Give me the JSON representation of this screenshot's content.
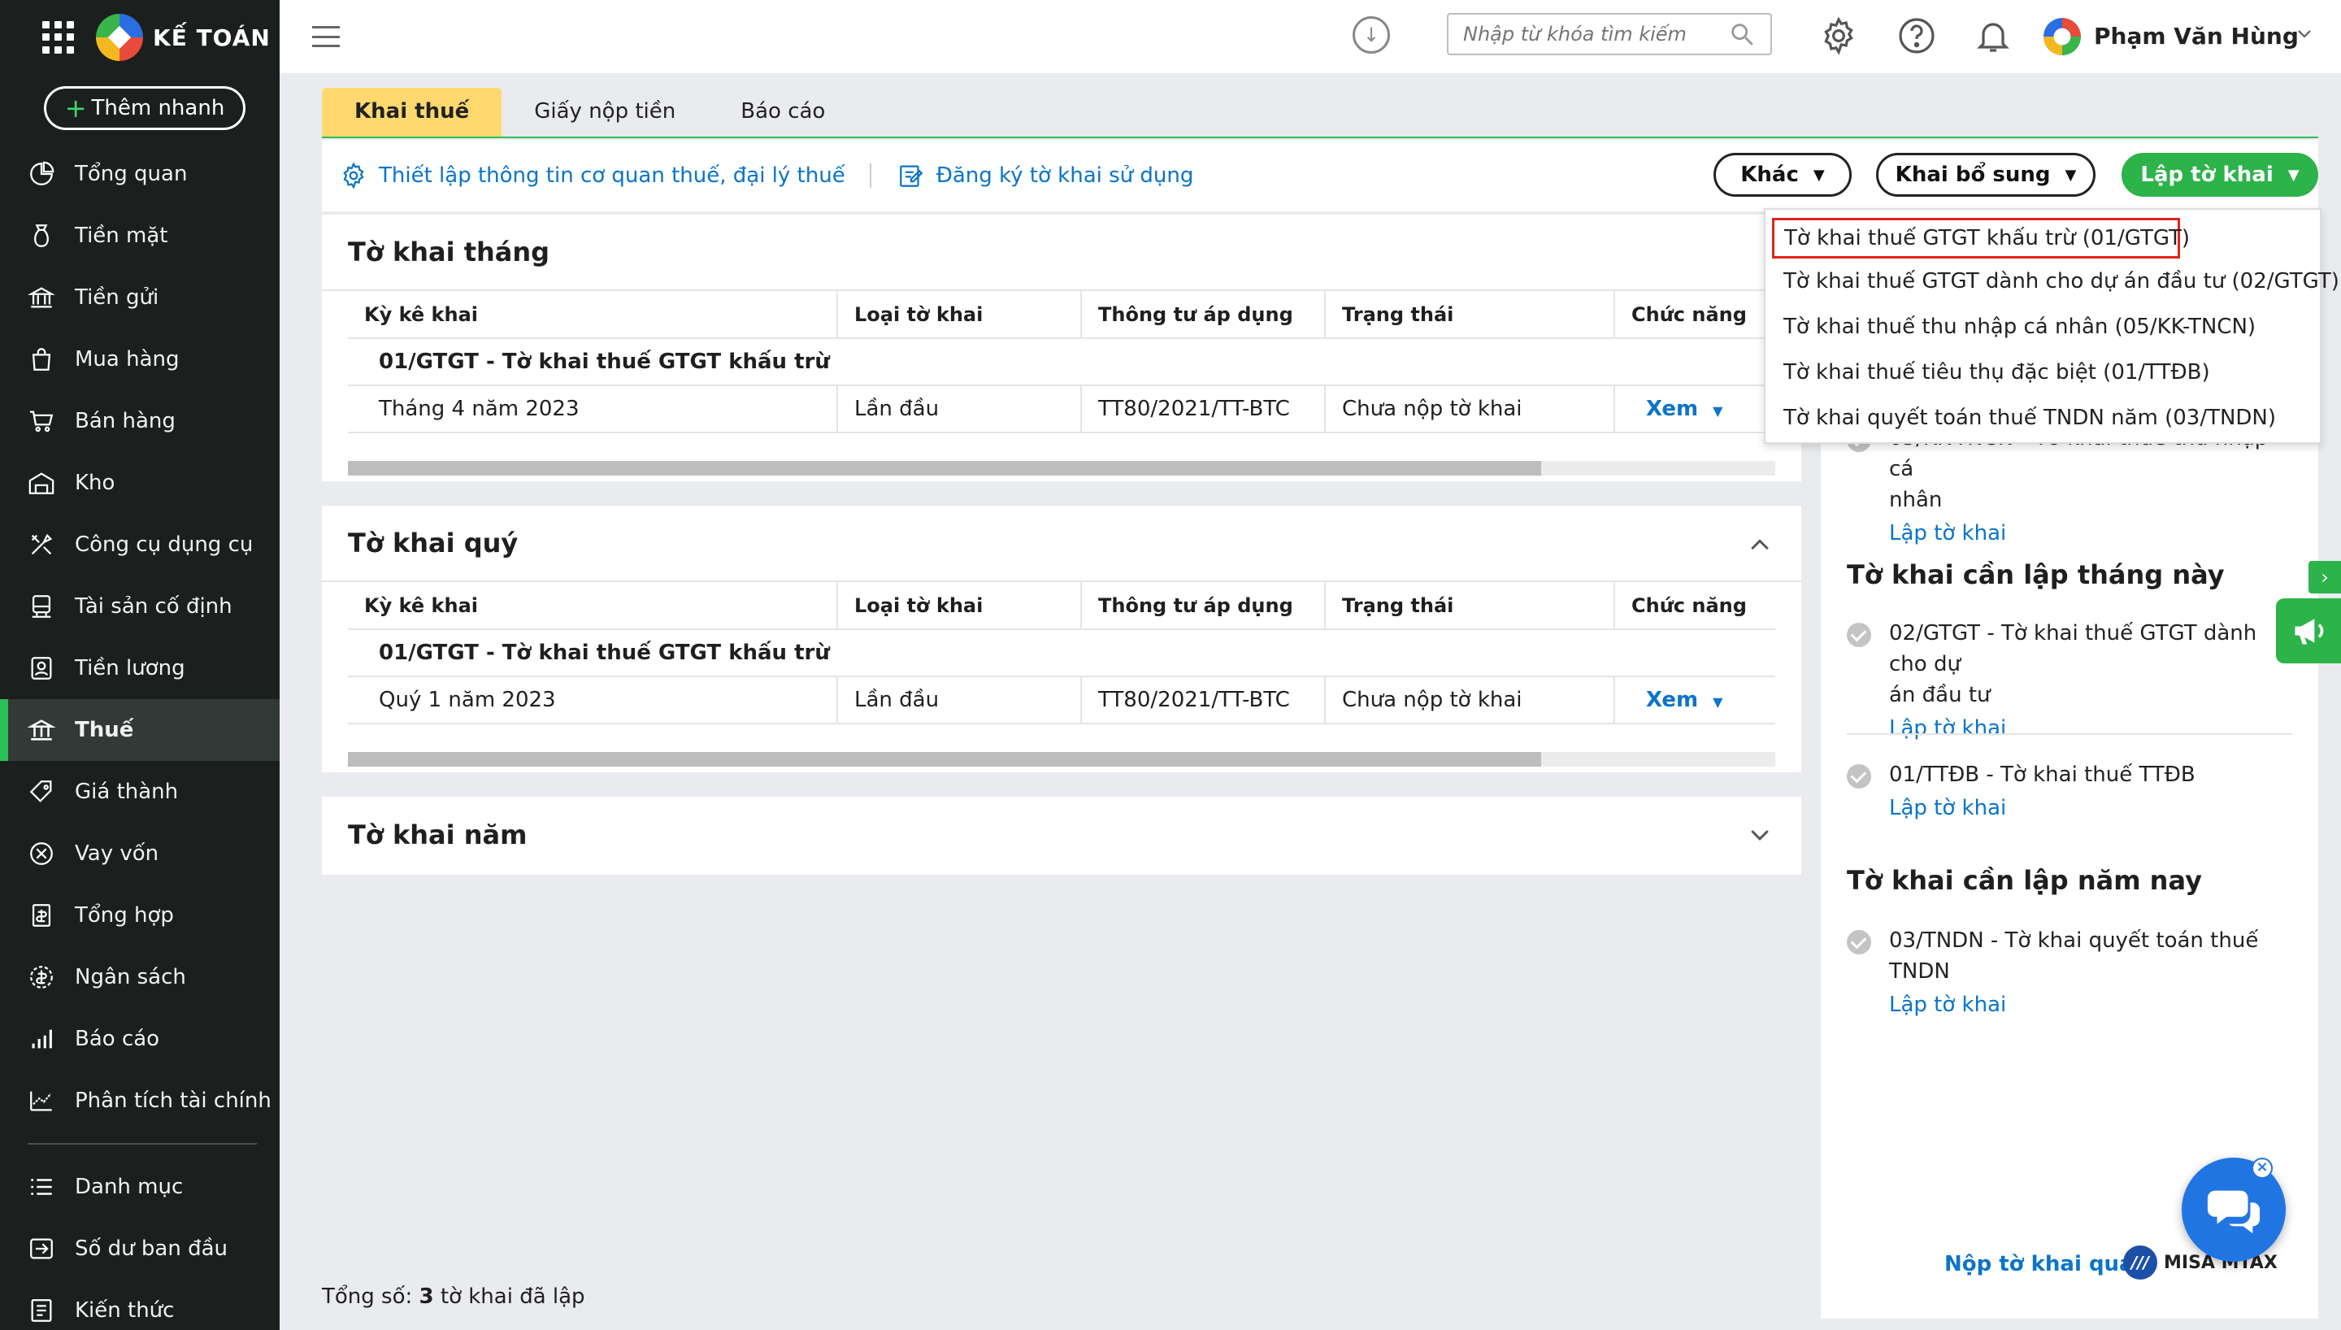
{
  "app": {
    "name": "KẾ TOÁN",
    "quick_add": "Thêm nhanh"
  },
  "sidebar": {
    "items": [
      {
        "label": "Tổng quan",
        "icon": "dashboard-icon"
      },
      {
        "label": "Tiền mặt",
        "icon": "cash-icon"
      },
      {
        "label": "Tiền gửi",
        "icon": "bank-icon"
      },
      {
        "label": "Mua hàng",
        "icon": "shopping-bag-icon"
      },
      {
        "label": "Bán hàng",
        "icon": "cart-icon"
      },
      {
        "label": "Kho",
        "icon": "warehouse-icon"
      },
      {
        "label": "Công cụ dụng cụ",
        "icon": "tools-icon"
      },
      {
        "label": "Tài sản cố định",
        "icon": "asset-icon"
      },
      {
        "label": "Tiền lương",
        "icon": "payroll-icon"
      },
      {
        "label": "Thuế",
        "icon": "tax-icon",
        "active": true
      },
      {
        "label": "Giá thành",
        "icon": "price-tag-icon"
      },
      {
        "label": "Vay vốn",
        "icon": "loan-icon"
      },
      {
        "label": "Tổng hợp",
        "icon": "summary-icon"
      },
      {
        "label": "Ngân sách",
        "icon": "budget-icon"
      },
      {
        "label": "Báo cáo",
        "icon": "report-chart-icon"
      },
      {
        "label": "Phân tích tài chính",
        "icon": "analysis-icon"
      },
      {
        "label": "Danh mục",
        "icon": "list-icon"
      },
      {
        "label": "Số dư ban đầu",
        "icon": "opening-balance-icon"
      },
      {
        "label": "Kiến thức",
        "icon": "knowledge-icon"
      }
    ]
  },
  "topbar": {
    "search_placeholder": "Nhập từ khóa tìm kiếm",
    "user_name": "Phạm Văn Hùng"
  },
  "tabs": [
    {
      "label": "Khai thuế",
      "active": true
    },
    {
      "label": "Giấy nộp tiền"
    },
    {
      "label": "Báo cáo"
    }
  ],
  "actions": {
    "setup_link": "Thiết lập thông tin cơ quan thuế, đại lý thuế",
    "register_link": "Đăng ký tờ khai sử dụng",
    "other": "Khác",
    "supplement": "Khai bổ sung",
    "create": "Lập tờ khai"
  },
  "columns": [
    "Kỳ kê khai",
    "Loại tờ khai",
    "Thông tư áp dụng",
    "Trạng thái",
    "Chức năng"
  ],
  "monthly": {
    "title": "Tờ khai tháng",
    "group": "01/GTGT - Tờ khai thuế GTGT khấu trừ",
    "row": {
      "period": "Tháng 4 năm 2023",
      "type": "Lần đầu",
      "circular": "TT80/2021/TT-BTC",
      "status": "Chưa nộp tờ khai",
      "action": "Xem"
    }
  },
  "quarterly": {
    "title": "Tờ khai quý",
    "group": "01/GTGT - Tờ khai thuế GTGT khấu trừ",
    "row": {
      "period": "Quý 1 năm 2023",
      "type": "Lần đầu",
      "circular": "TT80/2021/TT-BTC",
      "status": "Chưa nộp tờ khai",
      "action": "Xem"
    }
  },
  "yearly": {
    "title": "Tờ khai năm"
  },
  "footer": {
    "label": "Tổng số:",
    "count": "3",
    "suffix": "tờ khai đã lập"
  },
  "right_panel": {
    "partial_item": {
      "text_line1": "05/KK-TNCN - Tờ khai thuế thu nhập cá",
      "text_line2": "nhân",
      "link": "Lập tờ khai"
    },
    "month_heading": "Tờ khai cần lập tháng này",
    "month_items": [
      {
        "text_line1": "02/GTGT - Tờ khai thuế GTGT dành cho dự",
        "text_line2": "án đầu tư",
        "link": "Lập tờ khai"
      },
      {
        "text_line1": "01/TTĐB - Tờ khai thuế TTĐB",
        "link": "Lập tờ khai"
      }
    ],
    "year_heading": "Tờ khai cần lập năm nay",
    "year_items": [
      {
        "text_line1": "03/TNDN - Tờ khai quyết toán thuế TNDN",
        "link": "Lập tờ khai"
      }
    ],
    "submit_via": "Nộp tờ khai qua",
    "misa_brand": "MISA MTAX"
  },
  "dropdown": {
    "items": [
      "Tờ khai thuế GTGT khấu trừ (01/GTGT)",
      "Tờ khai thuế GTGT dành cho dự án đầu tư (02/GTGT)",
      "Tờ khai thuế thu nhập cá nhân (05/KK-TNCN)",
      "Tờ khai thuế tiêu thụ đặc biệt (01/TTĐB)",
      "Tờ khai quyết toán thuế TNDN năm (03/TNDN)"
    ],
    "selected_index": 0
  },
  "colors": {
    "accent_green": "#2cb34a",
    "link_blue": "#0a74c9",
    "tab_yellow": "#ffd86e",
    "sidebar_bg": "#1b1f1d",
    "highlight_red": "#e0231a"
  }
}
